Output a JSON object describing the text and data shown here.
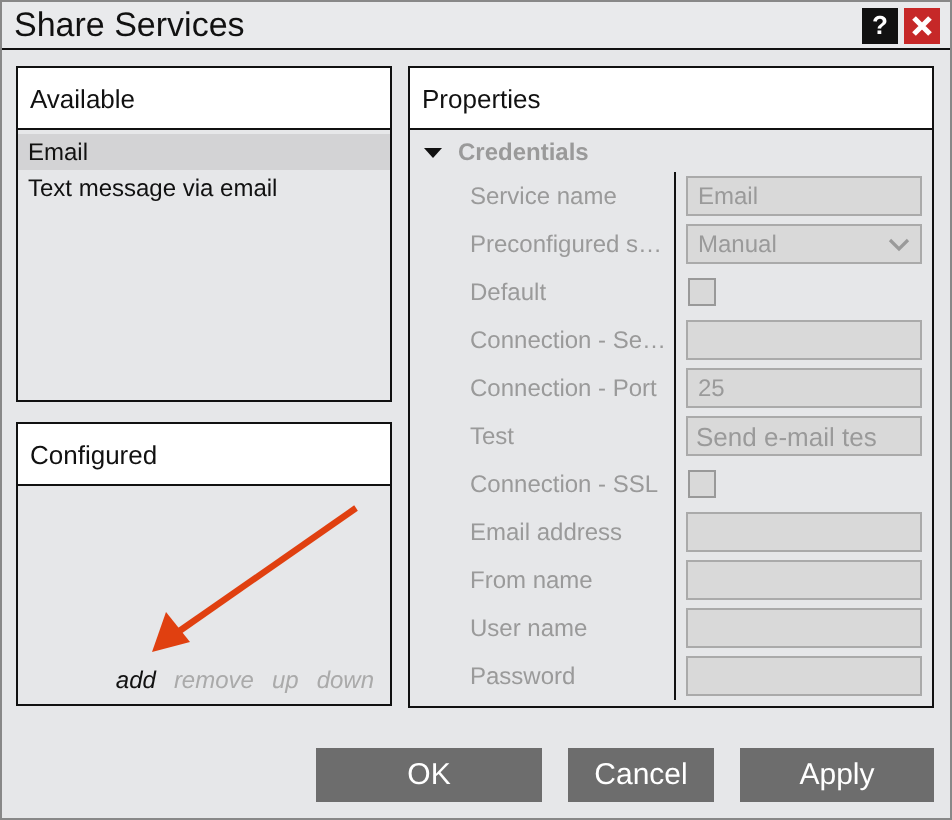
{
  "window": {
    "title": "Share Services",
    "help_button": "?"
  },
  "available": {
    "title": "Available",
    "items": [
      {
        "label": "Email",
        "selected": true
      },
      {
        "label": "Text message via email",
        "selected": false
      }
    ]
  },
  "configured": {
    "title": "Configured",
    "actions": [
      {
        "label": "add",
        "disabled": false
      },
      {
        "label": "remove",
        "disabled": true
      },
      {
        "label": "up",
        "disabled": true
      },
      {
        "label": "down",
        "disabled": true
      }
    ]
  },
  "properties": {
    "title": "Properties",
    "section": {
      "title": "Credentials",
      "expanded": true,
      "disabled": true,
      "fields": [
        {
          "label": "Service name",
          "kind": "text",
          "value": "Email"
        },
        {
          "label": "Preconfigured s…",
          "kind": "select",
          "value": "Manual"
        },
        {
          "label": "Default",
          "kind": "checkbox",
          "checked": false
        },
        {
          "label": "Connection - Se…",
          "kind": "text"
        },
        {
          "label": "Connection - Port",
          "kind": "text",
          "value": "25"
        },
        {
          "label": "Test",
          "kind": "button",
          "value": "Send e-mail tes"
        },
        {
          "label": "Connection - SSL",
          "kind": "checkbox",
          "checked": false
        },
        {
          "label": "Email address",
          "kind": "text"
        },
        {
          "label": "From name",
          "kind": "text"
        },
        {
          "label": "User name",
          "kind": "text"
        },
        {
          "label": "Password",
          "kind": "text"
        }
      ]
    }
  },
  "buttons": [
    "OK",
    "Cancel",
    "Apply"
  ]
}
